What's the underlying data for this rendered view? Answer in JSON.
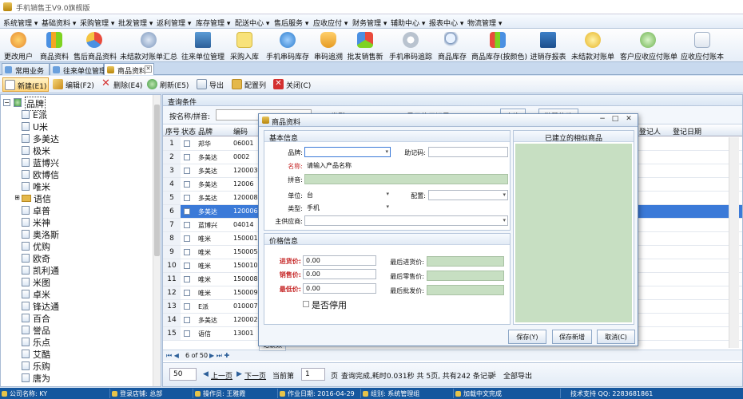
{
  "window": {
    "title": "手机销售王V9.0旗舰版"
  },
  "menu": [
    "系统管理 ▾",
    "基础资料 ▾",
    "采购管理 ▾",
    "批发管理 ▾",
    "返利管理 ▾",
    "库存管理 ▾",
    "配送中心 ▾",
    "售后服务 ▾",
    "应收应付 ▾",
    "财务管理 ▾",
    "辅助中心 ▾",
    "报表中心 ▾",
    "物流管理 ▾"
  ],
  "toolbar": [
    "更改用户",
    "商品资料",
    "售后商品资料",
    "未结款对账单汇总",
    "往来单位管理",
    "采购入库",
    "手机串码库存",
    "串码追溯",
    "批发销售新",
    "手机串码追踪",
    "商品库存",
    "商品库存(按颜色)",
    "进销存报表",
    "未结款对账单",
    "客户应收应付账单",
    "应收应付账本"
  ],
  "tabs": [
    "常用业务",
    "往来单位管理",
    "商品资料"
  ],
  "actions": [
    "新建(E1)",
    "编辑(F2)",
    "删除(E4)",
    "刷新(E5)",
    "导出",
    "配置列",
    "关闭(C)"
  ],
  "tree": {
    "root": "品牌",
    "items": [
      "E派",
      "U米",
      "多美达",
      "极米",
      "蓝博兴",
      "欧博信",
      "唯米",
      "语信",
      "卓普",
      "米神",
      "奥洛斯",
      "优购",
      "欧奇",
      "凯利通",
      "米图",
      "卓米",
      "锋达通",
      "百合",
      "誉品",
      "乐点",
      "艾酷",
      "乐购",
      "唐为"
    ]
  },
  "query": {
    "header": "查询条件",
    "label": "按名称/拼音:",
    "label2": "类型:",
    "option": "显示停用记录",
    "btn_query": "查询",
    "btn_batch": "批量修改"
  },
  "grid": {
    "columns": [
      "序号",
      "状态",
      "品牌",
      "编码"
    ],
    "right_columns": [
      "登记人",
      "登记日期"
    ],
    "rows": [
      {
        "n": "1",
        "brand": "邦华",
        "code": "06001"
      },
      {
        "n": "2",
        "brand": "多美达",
        "code": "0002"
      },
      {
        "n": "3",
        "brand": "多美达",
        "code": "120003"
      },
      {
        "n": "4",
        "brand": "多美达",
        "code": "12006"
      },
      {
        "n": "5",
        "brand": "多美达",
        "code": "120008"
      },
      {
        "n": "6",
        "brand": "多美达",
        "code": "120006"
      },
      {
        "n": "7",
        "brand": "蓝博兴",
        "code": "04014"
      },
      {
        "n": "8",
        "brand": "唯米",
        "code": "150001"
      },
      {
        "n": "9",
        "brand": "唯米",
        "code": "150005"
      },
      {
        "n": "10",
        "brand": "唯米",
        "code": "150010"
      },
      {
        "n": "11",
        "brand": "唯米",
        "code": "150008"
      },
      {
        "n": "12",
        "brand": "唯米",
        "code": "150009"
      },
      {
        "n": "13",
        "brand": "E派",
        "code": "010007"
      },
      {
        "n": "14",
        "brand": "多美达",
        "code": "120002"
      },
      {
        "n": "15",
        "brand": "语信",
        "code": "13001"
      }
    ],
    "selected_row": 6,
    "record_label": "记录数",
    "nav": "6 of 50"
  },
  "pager": {
    "page_size": "50",
    "prev": "上一页",
    "next": "下一页",
    "current_label": "当前第",
    "current": "1",
    "page_unit": "页",
    "status": "查询完成,耗时0.031秒  共 5页, 共有242 条记录",
    "export_all": "全部导出"
  },
  "dialog": {
    "title": "商品资料",
    "basic_header": "基本信息",
    "similar_header": "已建立的相似商品",
    "price_header": "价格信息",
    "fields": {
      "brand_label": "品牌:",
      "brand_value": "",
      "helpcode_label": "助记码:",
      "name_label": "名称:",
      "name_placeholder": "请输入产品名称",
      "pinyin_label": "拼音:",
      "unit_label": "单位:",
      "unit_value": "台",
      "config_label": "配置:",
      "type_label": "类型:",
      "type_value": "手机",
      "supplier_label": "主供应商:",
      "purchase_label": "进货价:",
      "purchase_value": "0.00",
      "last_purchase_label": "最后进货价:",
      "sale_label": "销售价:",
      "sale_value": "0.00",
      "last_retail_label": "最后零售价:",
      "min_label": "最低价:",
      "min_value": "0.00",
      "last_wholesale_label": "最后批发价:",
      "disabled_label": "是否停用"
    },
    "buttons": {
      "save": "保存(Y)",
      "save_new": "保存新增",
      "cancel": "取消(C)"
    }
  },
  "status": [
    {
      "label": "公司名称:",
      "value": "KY"
    },
    {
      "label": "登录店铺:",
      "value": "总部"
    },
    {
      "label": "操作员:",
      "value": "王雅霞"
    },
    {
      "label": "作业日期:",
      "value": "2016-04-29"
    },
    {
      "label": "组别:",
      "value": "系统管理组"
    },
    {
      "label": "",
      "value": "加载中文完成"
    },
    {
      "label": "技术支持 QQ:",
      "value": "2283681861"
    }
  ],
  "colors": {
    "accent": "#15579e",
    "selection": "#3b7ad8",
    "required": "#c62828",
    "field_green": "#c7dfc2"
  }
}
